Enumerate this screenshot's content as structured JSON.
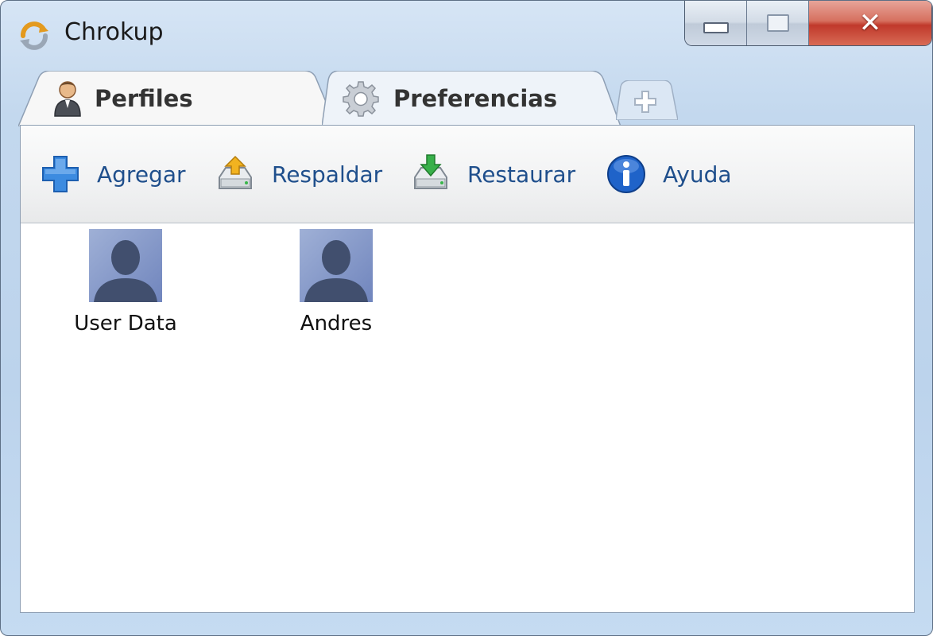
{
  "window": {
    "title": "Chrokup",
    "controls": [
      "minimize",
      "maximize",
      "close"
    ]
  },
  "tabs": [
    {
      "label": "Perfiles",
      "icon": "user-icon",
      "active": true
    },
    {
      "label": "Preferencias",
      "icon": "gear-icon",
      "active": false
    },
    {
      "label": "",
      "icon": "plus-icon",
      "active": false
    }
  ],
  "toolbar": {
    "items": [
      {
        "label": "Agregar",
        "icon": "add-icon"
      },
      {
        "label": "Respaldar",
        "icon": "backup-icon"
      },
      {
        "label": "Restaurar",
        "icon": "restore-icon"
      },
      {
        "label": "Ayuda",
        "icon": "info-icon"
      }
    ]
  },
  "profiles": [
    {
      "name": "User Data",
      "icon": "default-avatar"
    },
    {
      "name": "Andres",
      "icon": "default-avatar"
    }
  ],
  "colors": {
    "accent_text": "#1f4f8c",
    "frame": "#c3d8ee",
    "close_button": "#c0392b"
  }
}
